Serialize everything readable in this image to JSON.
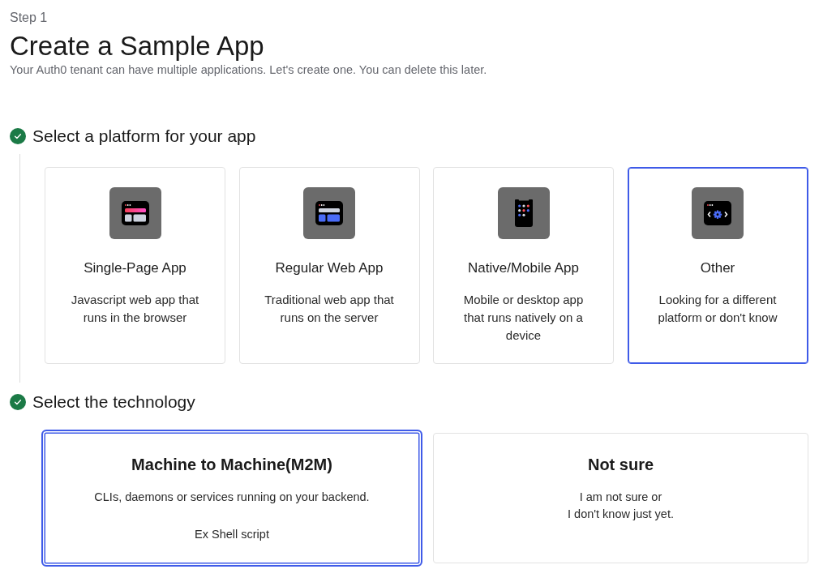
{
  "header": {
    "step": "Step 1",
    "title": "Create a Sample App",
    "subtitle": "Your Auth0 tenant can have multiple applications. Let's create one. You can delete this later."
  },
  "sections": [
    {
      "kind": "platform",
      "title": "Select a platform for your app",
      "completed": true,
      "options": [
        {
          "title": "Single-Page App",
          "description": "Javascript web app that runs in the browser",
          "selected": false
        },
        {
          "title": "Regular Web App",
          "description": "Traditional web app that runs on the server",
          "selected": false
        },
        {
          "title": "Native/Mobile App",
          "description": "Mobile or desktop app that runs natively on a device",
          "selected": false
        },
        {
          "title": "Other",
          "description": "Looking for a different platform or don't know",
          "selected": true
        }
      ]
    },
    {
      "kind": "technology",
      "title": "Select the technology",
      "completed": true,
      "options": [
        {
          "title": "Machine to Machine(M2M)",
          "description": "CLIs, daemons or services running on your backend.",
          "example": "Ex Shell script",
          "selected": true
        },
        {
          "title": "Not sure",
          "description": "I am not sure or\nI don't know just yet.",
          "selected": false
        }
      ]
    }
  ]
}
